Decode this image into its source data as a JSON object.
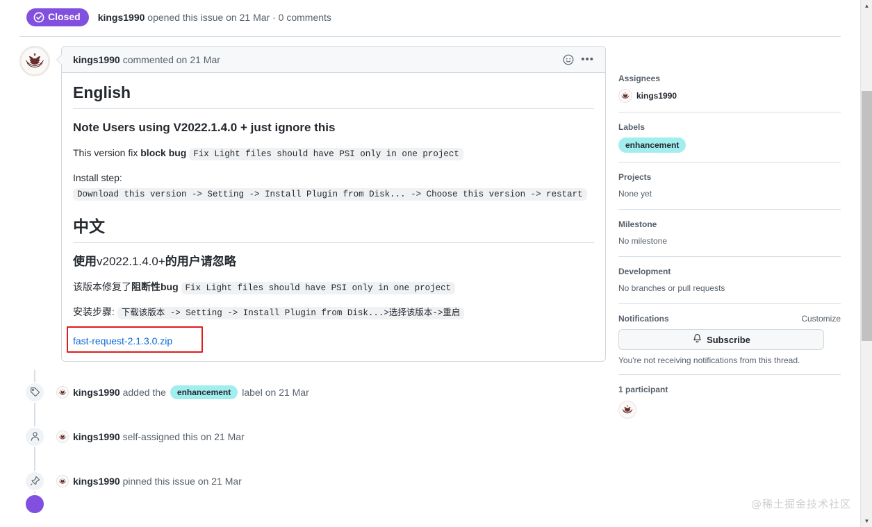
{
  "issue_header": {
    "state": "Closed",
    "state_color": "#8250df",
    "author": "kings1990",
    "meta_before": " opened this issue on ",
    "date": "21 Mar",
    "separator": " · ",
    "comments": "0 comments"
  },
  "comment": {
    "author": "kings1990",
    "action": " commented on ",
    "date": "21 Mar",
    "reaction_icon": "smiley-icon",
    "menu_icon": "kebab-menu-icon",
    "body": {
      "h1_english": "English",
      "h3_note": "Note Users using V2022.1.4.0 + just ignore this",
      "p1_prefix": "This version fix ",
      "p1_bold": "block bug",
      "p1_code": "Fix Light files should have PSI only in one project",
      "p2_prefix": "Install step: ",
      "p2_code": "Download this version -> Setting -> Install Plugin from Disk... -> Choose this version -> restart",
      "h1_chinese": "中文",
      "h3_note_cn_a": "使用",
      "h3_note_cn_b": "v2022.1.4.0+",
      "h3_note_cn_c": "的用户请忽略",
      "p3_prefix": "该版本修复了",
      "p3_bold": "阻断性",
      "p3_suffix": "bug ",
      "p3_code": "Fix Light files should have PSI only in one project",
      "p4_prefix": "安装步骤: ",
      "p4_code": "下载该版本 -> Setting -> Install Plugin from Disk...>选择该版本->重启",
      "attachment_link": "fast-request-2.1.3.0.zip",
      "attachment_link_color": "#0969da",
      "annotation_box_color": "#e01b1b"
    }
  },
  "timeline": [
    {
      "icon": "tag-icon",
      "author": "kings1990",
      "text_before": " added the ",
      "label": "enhancement",
      "text_after": " label on ",
      "date": "21 Mar"
    },
    {
      "icon": "person-icon",
      "author": "kings1990",
      "text_before": " self-assigned this on ",
      "label": null,
      "text_after": "",
      "date": "21 Mar"
    },
    {
      "icon": "pin-icon",
      "author": "kings1990",
      "text_before": " pinned this issue on ",
      "label": null,
      "text_after": "",
      "date": "21 Mar"
    }
  ],
  "sidebar": {
    "assignees": {
      "title": "Assignees",
      "user": "kings1990"
    },
    "labels": {
      "title": "Labels",
      "chip": "enhancement",
      "chip_color": "#a2eeef"
    },
    "projects": {
      "title": "Projects",
      "value": "None yet"
    },
    "milestone": {
      "title": "Milestone",
      "value": "No milestone"
    },
    "development": {
      "title": "Development",
      "value": "No branches or pull requests"
    },
    "notifications": {
      "title": "Notifications",
      "customize": "Customize",
      "subscribe_button": "Subscribe",
      "subscribe_icon": "bell-icon",
      "note": "You're not receiving notifications from this thread."
    },
    "participants": {
      "title": "1 participant"
    }
  },
  "watermark": "@稀土掘金技术社区",
  "scrollbar": {
    "up_arrow": "▲",
    "down_arrow": "▼"
  }
}
